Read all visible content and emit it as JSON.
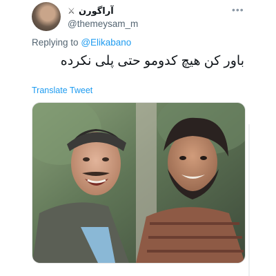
{
  "tweet": {
    "display_name": "آراگورن",
    "handle": "@themeysam_m",
    "more_icon": "more-icon",
    "replying_prefix": "Replying to",
    "replying_to": "@Elikabano",
    "text": "باور کن هیچ کدومو حتی پلی نکرده",
    "translate_label": "Translate Tweet"
  },
  "icons": {
    "badge": "crossed-swords-icon",
    "more": "more-icon"
  },
  "colors": {
    "link": "#1d9bf0",
    "secondary_text": "#536471",
    "primary_text": "#0f1419"
  }
}
